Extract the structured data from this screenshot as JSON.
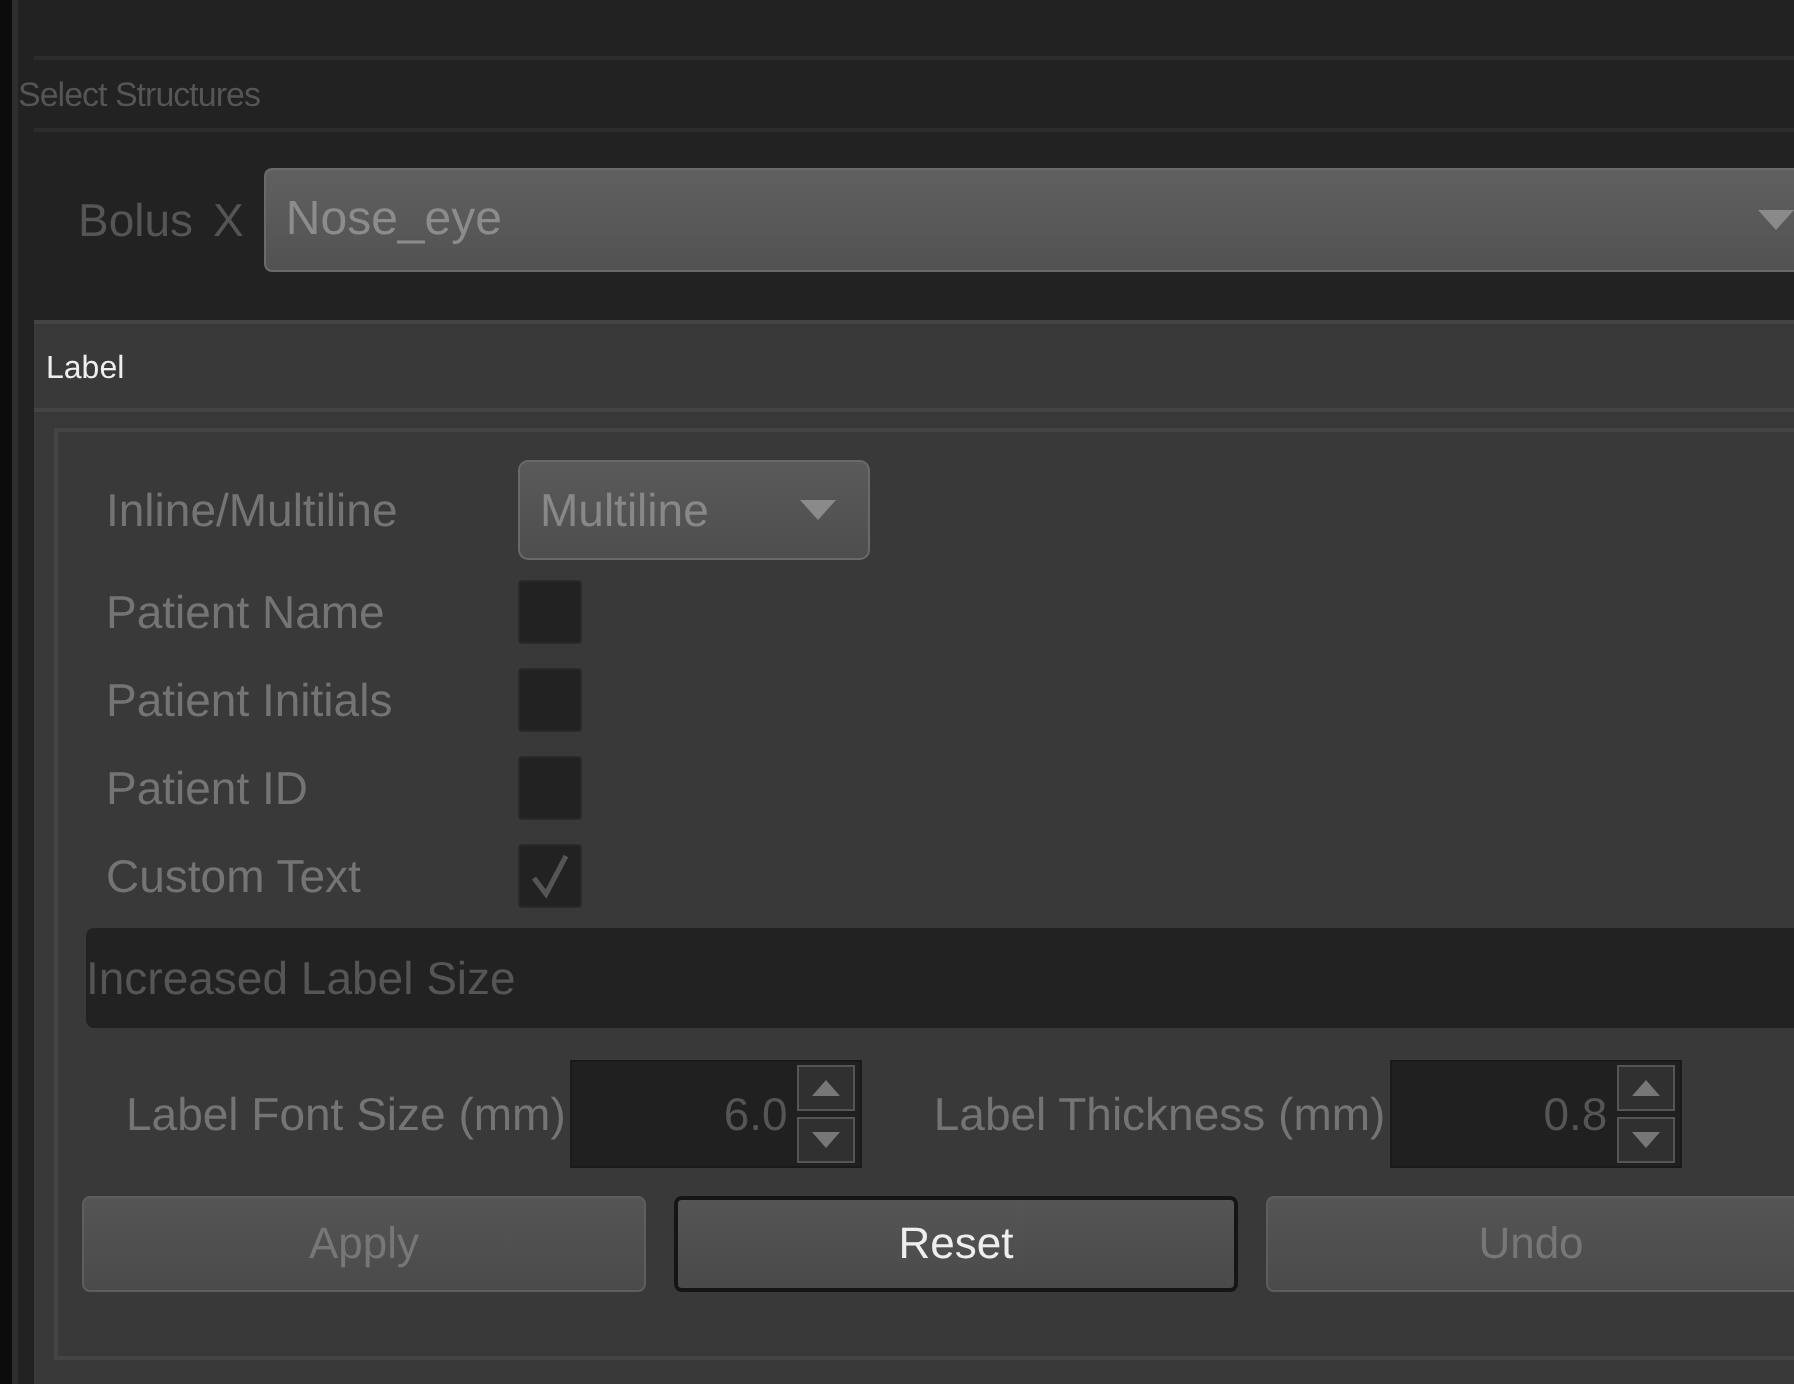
{
  "section_title": "Select Structures",
  "structure": {
    "label": "Bolus",
    "remove": "X",
    "value": "Nose_eye"
  },
  "panel": {
    "title": "Label",
    "mode": {
      "label": "Inline/Multiline",
      "value": "Multiline"
    },
    "options": [
      {
        "label": "Patient Name",
        "checked": false
      },
      {
        "label": "Patient Initials",
        "checked": false
      },
      {
        "label": "Patient ID",
        "checked": false
      },
      {
        "label": "Custom Text",
        "checked": true
      }
    ],
    "custom_text": "Increased Label Size",
    "spinners": [
      {
        "label": "Label Font Size (mm)",
        "value": "6.0"
      },
      {
        "label": "Label Thickness (mm)",
        "value": "0.8"
      }
    ],
    "buttons": [
      {
        "label": "Apply",
        "disabled": true
      },
      {
        "label": "Reset",
        "disabled": false
      },
      {
        "label": "Undo",
        "disabled": true
      }
    ]
  }
}
